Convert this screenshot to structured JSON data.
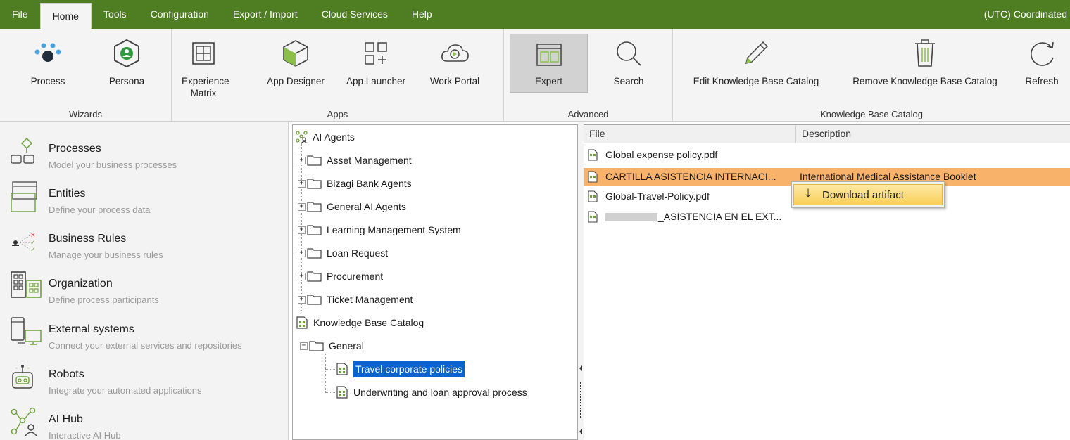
{
  "menu": {
    "tabs": [
      "File",
      "Home",
      "Tools",
      "Configuration",
      "Export / Import",
      "Cloud Services",
      "Help"
    ],
    "active": "Home",
    "timezone": "(UTC) Coordinated"
  },
  "ribbon": {
    "wizards": {
      "label": "Wizards",
      "process": "Process",
      "persona": "Persona"
    },
    "apps": {
      "label": "Apps",
      "experience_matrix_1": "Experience",
      "experience_matrix_2": "Matrix",
      "app_designer": "App Designer",
      "app_launcher": "App Launcher",
      "work_portal": "Work Portal"
    },
    "advanced": {
      "label": "Advanced",
      "expert": "Expert",
      "search": "Search"
    },
    "kb": {
      "label": "Knowledge Base Catalog",
      "edit": "Edit Knowledge Base Catalog",
      "remove": "Remove Knowledge Base Catalog",
      "refresh": "Refresh"
    }
  },
  "nav": [
    {
      "title": "Processes",
      "subtitle": "Model your business processes"
    },
    {
      "title": "Entities",
      "subtitle": "Define your process data"
    },
    {
      "title": "Business Rules",
      "subtitle": "Manage your business rules"
    },
    {
      "title": "Organization",
      "subtitle": "Define process participants"
    },
    {
      "title": "External systems",
      "subtitle": "Connect your external services and repositories"
    },
    {
      "title": "Robots",
      "subtitle": "Integrate your automated applications"
    },
    {
      "title": "AI Hub",
      "subtitle": "Interactive AI Hub"
    }
  ],
  "tree": {
    "root": "AI Agents",
    "agents": [
      "Asset Management",
      "Bizagi Bank Agents",
      "General AI Agents",
      "Learning Management System",
      "Loan Request",
      "Procurement",
      "Ticket Management"
    ],
    "kb_root": "Knowledge Base Catalog",
    "general": "General",
    "selected": "Travel corporate policies",
    "other": "Underwriting and loan approval process"
  },
  "files": {
    "col_file": "File",
    "col_description": "Description",
    "rows": [
      {
        "name": "Global expense policy.pdf",
        "description": ""
      },
      {
        "name": "CARTILLA ASISTENCIA INTERNACI...",
        "description": "International Medical Assistance Booklet"
      },
      {
        "name": "Global-Travel-Policy.pdf",
        "description": ""
      },
      {
        "name": "_ASISTENCIA EN EL EXT...",
        "description": ""
      }
    ]
  },
  "context_menu": {
    "download": "Download artifact"
  },
  "colors": {
    "menubar": "#4e7d22",
    "highlight_row": "#f8b26a",
    "selection": "#0a64d0"
  }
}
